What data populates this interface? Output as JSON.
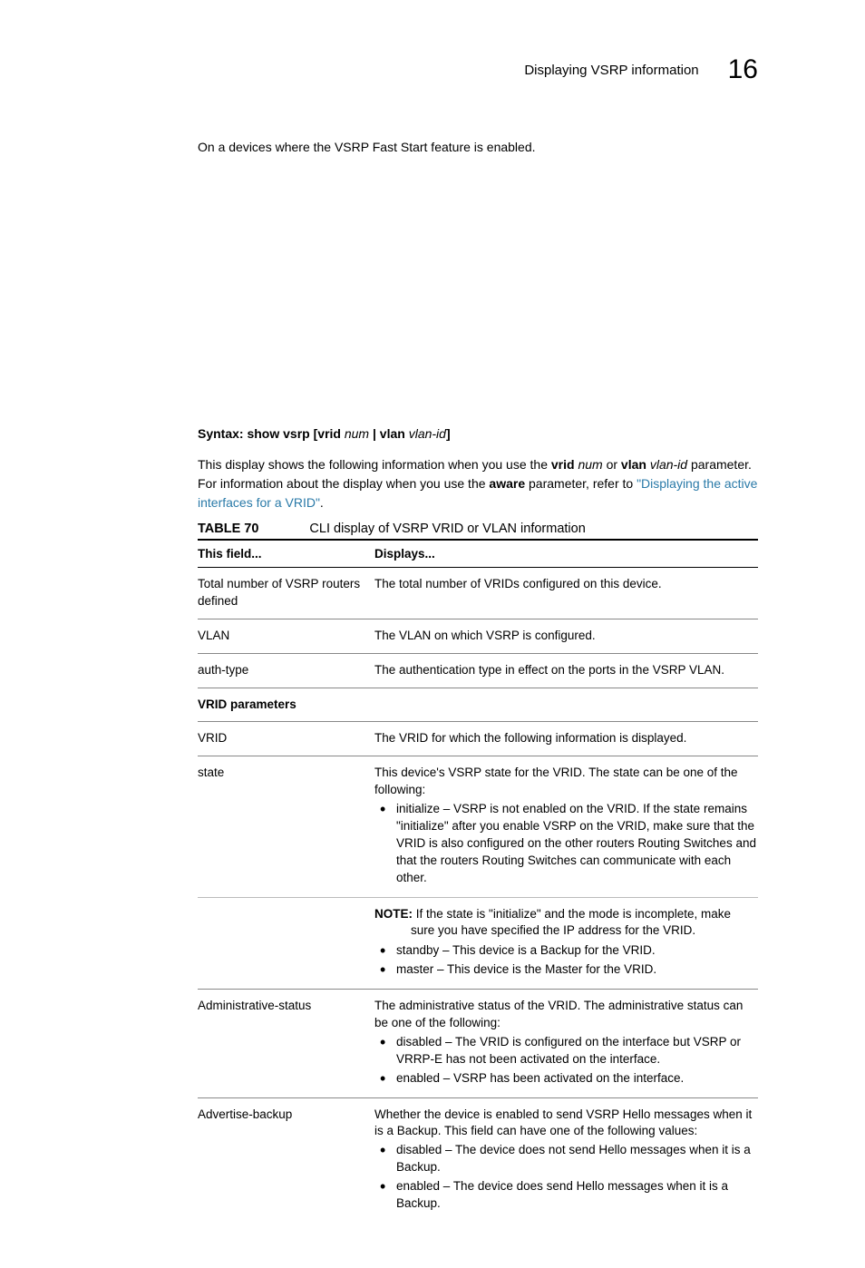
{
  "header": {
    "title": "Displaying VSRP information",
    "chapter_number": "16"
  },
  "intro": "On a devices where the VSRP Fast Start feature is enabled.",
  "syntax": {
    "label": "Syntax:",
    "cmd1": "show vsrp",
    "br1": "[",
    "kw1": "vrid",
    "arg1": "num",
    "sep": " | ",
    "kw2": "vlan",
    "arg2": "vlan-id",
    "br2": "]"
  },
  "desc": {
    "part1": "This display shows the following information when you use the ",
    "kw1": "vrid",
    "arg1": " num",
    "mid": " or ",
    "kw2": "vlan",
    "arg2": " vlan-id",
    "part2": " parameter. For information about the display when you use the ",
    "kw3": "aware",
    "part3": " parameter, refer to ",
    "link": "\"Displaying the active interfaces for a VRID\"",
    "end": "."
  },
  "table": {
    "number": "TABLE 70",
    "caption": "CLI display of VSRP VRID or VLAN information",
    "col_field": "This field...",
    "col_disp": "Displays...",
    "rows": {
      "r1": {
        "field": "Total number of VSRP routers defined",
        "disp": "The total number of VRIDs configured on this device."
      },
      "r2": {
        "field": "VLAN",
        "disp": "The VLAN on which VSRP is configured."
      },
      "r3": {
        "field": "auth-type",
        "disp": "The authentication type in effect on the ports in the VSRP VLAN."
      },
      "sec1": "VRID parameters",
      "r4": {
        "field": "VRID",
        "disp": "The VRID for which the following information is displayed."
      },
      "r5": {
        "field": "state",
        "intro": "This device's VSRP state for the VRID. The state can be one of the following:",
        "b1": "initialize – VSRP is not enabled on the VRID. If the state remains \"initialize\" after you enable VSRP on the VRID, make sure that the VRID is also configured on the other routers Routing Switches and that the routers Routing Switches can communicate with each other.",
        "note_label": "NOTE:",
        "note_text": "If the state is \"initialize\" and the mode is incomplete, make sure you have specified the IP address for the VRID.",
        "b2": "standby – This device is a Backup for the VRID.",
        "b3": "master – This device is the Master for the VRID."
      },
      "r6": {
        "field": "Administrative-status",
        "intro": "The administrative status of the VRID. The administrative status can be one of the following:",
        "b1": "disabled – The VRID is configured on the interface but VSRP or VRRP-E has not been activated on the interface.",
        "b2": "enabled – VSRP has been activated on the interface."
      },
      "r7": {
        "field": "Advertise-backup",
        "intro": "Whether the device is enabled to send VSRP Hello messages when it is a Backup. This field can have one of the following values:",
        "b1": "disabled – The device does not send Hello messages when it is a Backup.",
        "b2": "enabled – The device does send Hello messages when it is a Backup."
      }
    }
  }
}
